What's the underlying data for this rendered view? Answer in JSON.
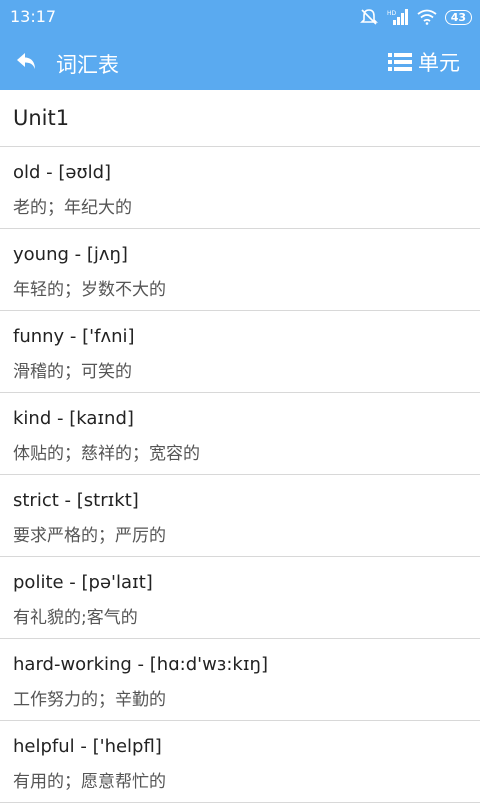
{
  "status": {
    "time": "13:17",
    "battery": "43"
  },
  "appbar": {
    "title": "词汇表",
    "unit_label": "单元"
  },
  "unit_header": "Unit1",
  "words": [
    {
      "word": "old  -  [əʊld]",
      "meaning": "老的；年纪大的"
    },
    {
      "word": "young  -  [jʌŋ]",
      "meaning": "年轻的；岁数不大的"
    },
    {
      "word": "funny  -  ['fʌni]",
      "meaning": "滑稽的；可笑的"
    },
    {
      "word": "kind  -  [kaɪnd]",
      "meaning": "体贴的；慈祥的；宽容的"
    },
    {
      "word": "strict  -  [strɪkt]",
      "meaning": "要求严格的；严厉的"
    },
    {
      "word": "polite  -  [pə'laɪt]",
      "meaning": "有礼貌的;客气的"
    },
    {
      "word": "hard-working  -  [hɑ:d'wɜ:kɪŋ]",
      "meaning": "工作努力的；辛勤的"
    },
    {
      "word": "helpful  -  ['helpfl]",
      "meaning": "有用的；愿意帮忙的"
    }
  ]
}
